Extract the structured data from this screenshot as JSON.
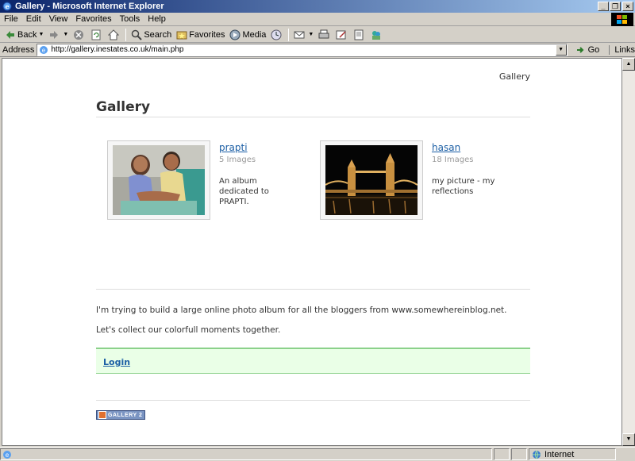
{
  "window": {
    "title": "Gallery - Microsoft Internet Explorer",
    "buttons": [
      "_",
      "❐",
      "×"
    ]
  },
  "menu": [
    {
      "label": "File"
    },
    {
      "label": "Edit"
    },
    {
      "label": "View"
    },
    {
      "label": "Favorites"
    },
    {
      "label": "Tools"
    },
    {
      "label": "Help"
    }
  ],
  "toolbar": {
    "back": "Back",
    "search": "Search",
    "favorites": "Favorites",
    "media": "Media"
  },
  "address": {
    "label": "Address",
    "url": "http://gallery.inestates.co.uk/main.php",
    "go": "Go",
    "links": "Links"
  },
  "page": {
    "breadcrumb": "Gallery",
    "title": "Gallery",
    "albums": [
      {
        "title": "prapti",
        "count": "5 Images",
        "description": "An album dedicated to PRAPTI."
      },
      {
        "title": "hasan",
        "count": "18 Images",
        "description": "my picture - my reflections"
      }
    ],
    "intro_1": "I'm trying to build a large online photo album for all the bloggers from www.somewhereinblog.net.",
    "intro_2": "Let's collect our colorfull moments together.",
    "login": "Login",
    "badge": "GALLERY 2"
  },
  "status": {
    "zone": "Internet"
  }
}
